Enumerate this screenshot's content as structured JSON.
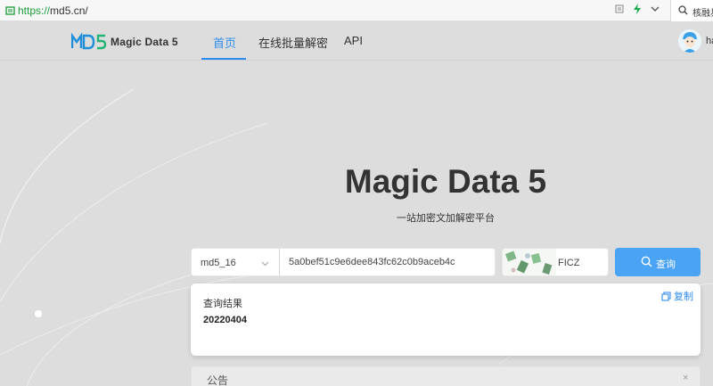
{
  "browser": {
    "url_scheme": "https://",
    "url_rest": "md5.cn/",
    "search_text": "核融易"
  },
  "header": {
    "brand": "Magic Data 5",
    "nav": [
      "首页",
      "在线批量解密",
      "API"
    ],
    "user_name": "ha"
  },
  "hero": {
    "title": "Magic Data 5",
    "subtitle": "一站加密文加解密平台"
  },
  "search": {
    "hash_type": "md5_16",
    "hash_value": "5a0bef51c9e6dee843fc62c0b9aceb4c",
    "captcha_text": "FICZ",
    "button_label": "查询",
    "button_icon": "search-icon"
  },
  "result": {
    "label": "查询结果",
    "value": "20220404",
    "copy_label": "复制"
  },
  "notice": {
    "title": "公告",
    "close": "×"
  },
  "colors": {
    "accent": "#2d8cf0",
    "button": "#4aa3f5",
    "background": "#dddddd"
  }
}
